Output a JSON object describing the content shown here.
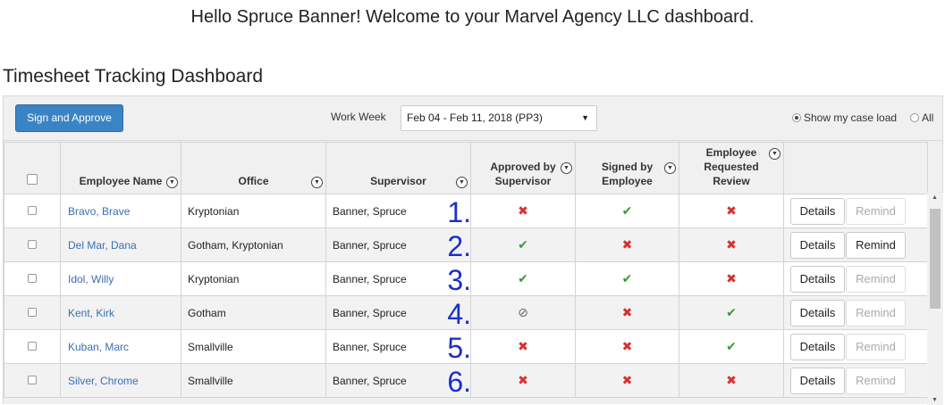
{
  "header": {
    "welcome": "Hello Spruce Banner! Welcome to your Marvel Agency LLC dashboard.",
    "page_title": "Timesheet Tracking Dashboard"
  },
  "toolbar": {
    "sign_approve_label": "Sign and Approve",
    "work_week_label": "Work Week",
    "work_week_value": "Feb 04 - Feb 11, 2018 (PP3)",
    "radio_case_load": "Show my case load",
    "radio_all": "All",
    "selected_radio": "case_load"
  },
  "columns": {
    "employee": "Employee Name",
    "office": "Office",
    "supervisor": "Supervisor",
    "approved_l1": "Approved by",
    "approved_l2": "Supervisor",
    "signed_l1": "Signed by",
    "signed_l2": "Employee",
    "review_l1": "Employee",
    "review_l2": "Requested",
    "review_l3": "Review"
  },
  "actions": {
    "details": "Details",
    "remind": "Remind"
  },
  "rows": [
    {
      "name": "Bravo, Brave",
      "office": "Kryptonian",
      "supervisor": "Banner, Spruce",
      "num": "1.",
      "approved": "no",
      "signed": "yes",
      "review": "no",
      "remind_enabled": false
    },
    {
      "name": "Del Mar, Dana",
      "office": "Gotham, Kryptonian",
      "supervisor": "Banner, Spruce",
      "num": "2.",
      "approved": "yes",
      "signed": "no",
      "review": "no",
      "remind_enabled": true
    },
    {
      "name": "Idol, Willy",
      "office": "Kryptonian",
      "supervisor": "Banner, Spruce",
      "num": "3.",
      "approved": "yes",
      "signed": "yes",
      "review": "no",
      "remind_enabled": false
    },
    {
      "name": "Kent, Kirk",
      "office": "Gotham",
      "supervisor": "Banner, Spruce",
      "num": "4.",
      "approved": "na",
      "signed": "no",
      "review": "yes",
      "remind_enabled": false
    },
    {
      "name": "Kuban, Marc",
      "office": "Smallville",
      "supervisor": "Banner, Spruce",
      "num": "5.",
      "approved": "no",
      "signed": "no",
      "review": "yes",
      "remind_enabled": false
    },
    {
      "name": "Silver, Chrome",
      "office": "Smallville",
      "supervisor": "Banner, Spruce",
      "num": "6.",
      "approved": "no",
      "signed": "no",
      "review": "no",
      "remind_enabled": false
    }
  ],
  "colors": {
    "primary_button": "#3a84c5",
    "link": "#3a6fb0",
    "check_green": "#3a9a3a",
    "cross_red": "#d9302c",
    "annotation_blue": "#1a2fc9"
  }
}
